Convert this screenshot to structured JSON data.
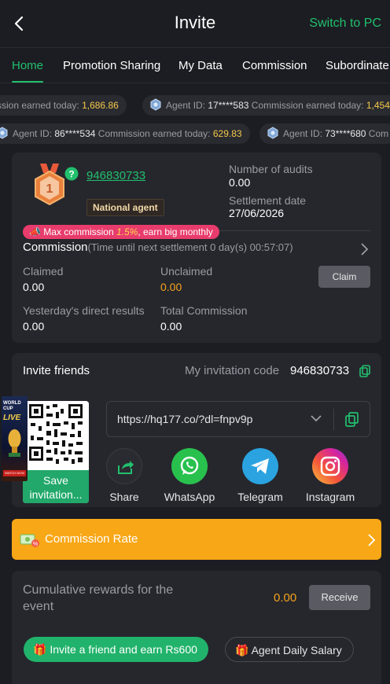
{
  "header": {
    "title": "Invite",
    "switch_label": "Switch to PC"
  },
  "tabs": [
    {
      "label": "Home"
    },
    {
      "label": "Promotion Sharing"
    },
    {
      "label": "My Data"
    },
    {
      "label": "Commission"
    },
    {
      "label": "Subordinate"
    }
  ],
  "ticker": {
    "row1": [
      {
        "prefix": "ssion earned today: ",
        "id": "",
        "amount": "1,686.86"
      },
      {
        "prefix": "Agent ID: ",
        "id": "17****583",
        "suffix": " Commission earned today: ",
        "amount": "1,454"
      }
    ],
    "row2": [
      {
        "prefix": "Agent ID: ",
        "id": "86****534",
        "suffix": " Commission earned today: ",
        "amount": "629.83"
      },
      {
        "prefix": "Agent ID: ",
        "id": "73****680",
        "suffix": " Com",
        "amount": ""
      }
    ]
  },
  "agent": {
    "rank": "1",
    "id": "946830733",
    "tag": "National agent",
    "audits_label": "Number of audits",
    "audits_value": "0.00",
    "settlement_label": "Settlement date",
    "settlement_value": "27/06/2026",
    "promo_prefix": "Max commission ",
    "promo_rate": "1.5%",
    "promo_suffix": ", earn big monthly",
    "commission_title": "Commission",
    "commission_note": "(Time until next settlement  0 day(s) 00:57:07)",
    "claimed_label": "Claimed",
    "claimed_value": "0.00",
    "unclaimed_label": "Unclaimed",
    "unclaimed_value": "0.00",
    "claim_button": "Claim",
    "yesterday_label": "Yesterday's direct results",
    "yesterday_value": "0.00",
    "total_label": "Total Commission",
    "total_value": "0.00"
  },
  "invite": {
    "title": "Invite friends",
    "code_label": "My invitation code",
    "code_value": "946830733",
    "url": "https://hq177.co/?dl=fnpv9p",
    "save_label_1": "Save",
    "save_label_2": "invitation...",
    "poster_text_1": "WORLD",
    "poster_text_2": "CUP",
    "poster_text_3": "LIVE",
    "poster_text_4": "WATCH NOW",
    "share": [
      {
        "label": "Share",
        "icon": "share-icon"
      },
      {
        "label": "WhatsApp",
        "icon": "whatsapp-icon"
      },
      {
        "label": "Telegram",
        "icon": "telegram-icon"
      },
      {
        "label": "Instagram",
        "icon": "instagram-icon"
      }
    ]
  },
  "commission_rate": {
    "label": "Commission Rate"
  },
  "rewards": {
    "cumulative_label": "Cumulative rewards for the event",
    "cumulative_value": "0.00",
    "receive_button": "Receive",
    "invite_button": "Invite a friend and earn Rs600",
    "salary_button": "Agent Daily Salary"
  },
  "colors": {
    "accent": "#21c06e",
    "background": "#1c1d22",
    "card": "#26272d",
    "gold": "#f5c84a",
    "orange": "#f8a716",
    "pink": "#e83c6c"
  }
}
